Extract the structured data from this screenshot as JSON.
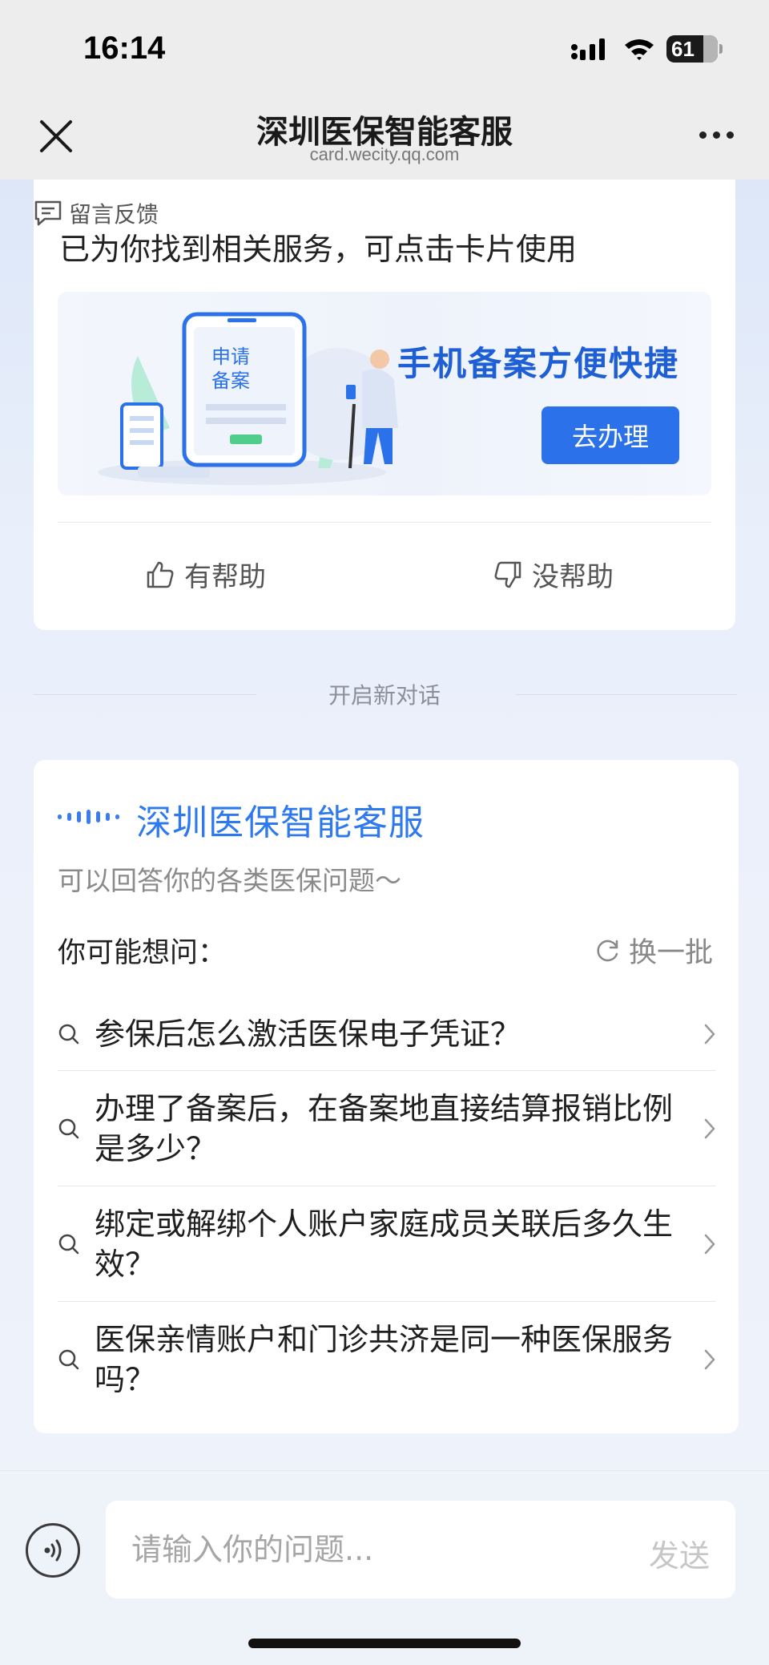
{
  "status_bar": {
    "time": "16:14",
    "battery_level": "61",
    "icons": [
      "signal-icon",
      "wifi-icon",
      "battery-icon"
    ]
  },
  "nav": {
    "title": "深圳医保智能客服",
    "url": "card.wecity.qq.com",
    "close_icon": "close-icon",
    "more_icon": "more-icon"
  },
  "answer_card": {
    "feedback_label": "留言反馈",
    "message": "已为你找到相关服务，可点击卡片使用",
    "banner": {
      "phone_line1": "申请",
      "phone_line2": "备案",
      "heading": "手机备案方便快捷",
      "button_label": "去办理"
    },
    "helpful_label": "有帮助",
    "not_helpful_label": "没帮助"
  },
  "new_chat_label": "开启新对话",
  "welcome_card": {
    "title": "深圳医保智能客服",
    "subtitle": "可以回答你的各类医保问题～",
    "suggest_label": "你可能想问：",
    "refresh_label": "换一批",
    "questions": [
      "参保后怎么激活医保电子凭证？",
      "办理了备案后，在备案地直接结算报销比例是多少？",
      "绑定或解绑个人账户家庭成员关联后多久生效？",
      "医保亲情账户和门诊共济是同一种医保服务吗？"
    ]
  },
  "input_bar": {
    "placeholder": "请输入你的问题...",
    "send_label": "发送"
  },
  "colors": {
    "accent": "#2f79ee",
    "button": "#2b71ea",
    "banner_heading": "#1e5fd6"
  }
}
